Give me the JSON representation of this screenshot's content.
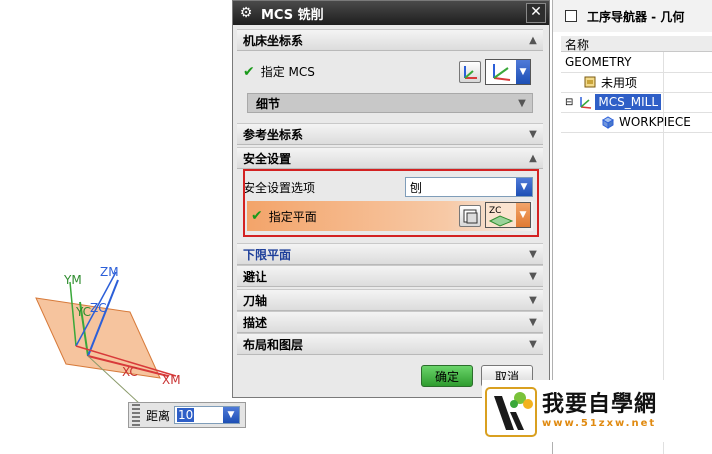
{
  "viewport": {
    "axes": {
      "zm": "ZM",
      "ym": "YM",
      "yc": "YC",
      "zc": "ZC",
      "xc": "XC",
      "xm": "XM"
    }
  },
  "distance_toolbar": {
    "label": "距离",
    "value": "10"
  },
  "dialog": {
    "title": "MCS 铣削",
    "sections": {
      "machine_csys": "机床坐标系",
      "specify_mcs": "指定 MCS",
      "details": "细节",
      "reference_csys": "参考坐标系",
      "clearance": "安全设置",
      "clearance_option_label": "安全设置选项",
      "clearance_option_value": "刨",
      "specify_plane": "指定平面",
      "lower_limit_plane": "下限平面",
      "avoidance": "避让",
      "tool_axis": "刀轴",
      "description": "描述",
      "layout_layer": "布局和图层"
    },
    "ok_label": "确定",
    "cancel_label": "取消"
  },
  "navigator": {
    "title": "工序导航器 - 几何",
    "column_name": "名称",
    "items": [
      {
        "label": "GEOMETRY"
      },
      {
        "label": "未用项"
      },
      {
        "label": "MCS_MILL"
      },
      {
        "label": "WORKPIECE"
      }
    ]
  },
  "watermark": {
    "text": "我要自學網",
    "url": "www.51zxw.net"
  },
  "colors": {
    "accent_blue": "#2f5fc7",
    "highlight_red": "#d32222",
    "ok_green": "#2e9c2e"
  }
}
